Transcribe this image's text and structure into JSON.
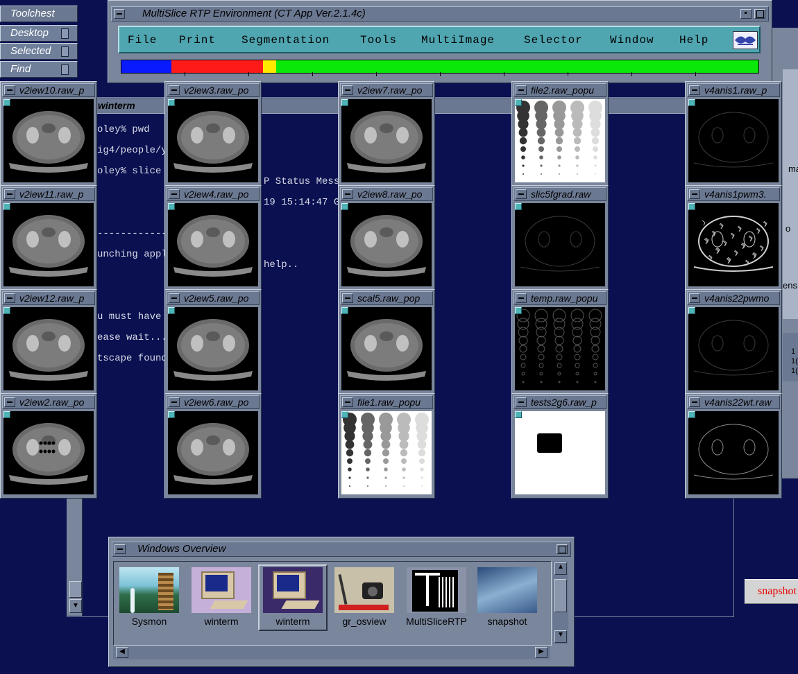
{
  "toolchest": {
    "title": "Toolchest",
    "items": [
      "Desktop",
      "Selected",
      "Find"
    ]
  },
  "main_window": {
    "title": "MultiSlice RTP Environment (CT App Ver.2.1.4c)",
    "menu": [
      "File",
      "Print",
      "Segmentation",
      "Tools",
      "MultiImage",
      "Selector",
      "Window",
      "Help"
    ],
    "color_bar": {
      "segments": [
        {
          "color": "#0a1aff",
          "fraction": 0.078
        },
        {
          "color": "#ff1a1a",
          "fraction": 0.144
        },
        {
          "color": "#ffe800",
          "fraction": 0.021
        },
        {
          "color": "#0ae80a",
          "fraction": 0.757
        }
      ]
    }
  },
  "winterm": {
    "title": "winterm",
    "lines_left": [
      "oley% pwd",
      "ig4/people/y",
      "oley% slice",
      "",
      "",
      "------------",
      "unching appl",
      "",
      "",
      "u must have",
      "ease wait...",
      "tscape found"
    ],
    "lines_right": [
      "P Status Mess",
      "19 15:14:47 G",
      "",
      "",
      "help.."
    ],
    "dashes_right": "-----"
  },
  "thumbnails": [
    {
      "title": "v2iew10.raw_p",
      "kind": "ct"
    },
    {
      "title": "v2iew11.raw_p",
      "kind": "ct"
    },
    {
      "title": "v2iew12.raw_p",
      "kind": "ct"
    },
    {
      "title": "v2iew2.raw_po",
      "kind": "ct-gas"
    },
    {
      "title": "v2iew3.raw_po",
      "kind": "ct"
    },
    {
      "title": "v2iew4.raw_po",
      "kind": "ct"
    },
    {
      "title": "v2iew5.raw_po",
      "kind": "ct"
    },
    {
      "title": "v2iew6.raw_po",
      "kind": "ct"
    },
    {
      "title": "v2iew7.raw_po",
      "kind": "ct"
    },
    {
      "title": "v2iew8.raw_po",
      "kind": "ct"
    },
    {
      "title": "scal5.raw_pop",
      "kind": "ct"
    },
    {
      "title": "file1.raw_popu",
      "kind": "dots"
    },
    {
      "title": "file2.raw_popu",
      "kind": "dots"
    },
    {
      "title": "slic5fgrad.raw",
      "kind": "edge-dim"
    },
    {
      "title": "temp.raw_popu",
      "kind": "circles"
    },
    {
      "title": "tests2g6.raw_p",
      "kind": "square"
    },
    {
      "title": "v4anis1.raw_p",
      "kind": "edge-dim"
    },
    {
      "title": "v4anis1pwm3.",
      "kind": "edge-bright"
    },
    {
      "title": "v4anis22pwmo",
      "kind": "edge-dim"
    },
    {
      "title": "v4anis22wt.raw",
      "kind": "edge-mid"
    }
  ],
  "windows_overview": {
    "title": "Windows Overview",
    "items": [
      {
        "label": "Sysmon",
        "icon": "sysmon-icon"
      },
      {
        "label": "winterm",
        "icon": "computer-icon"
      },
      {
        "label": "winterm",
        "icon": "computer-icon"
      },
      {
        "label": "gr_osview",
        "icon": "camera-icon"
      },
      {
        "label": "MultiSliceRTP",
        "icon": "multislice-icon"
      },
      {
        "label": "snapshot",
        "icon": "snapshot-icon"
      }
    ]
  },
  "right_edge": {
    "labels": [
      "ma",
      "o",
      "ens"
    ],
    "numbers": [
      "1",
      "1(",
      "1("
    ]
  },
  "snapshot_button": {
    "label": "snapshot"
  }
}
